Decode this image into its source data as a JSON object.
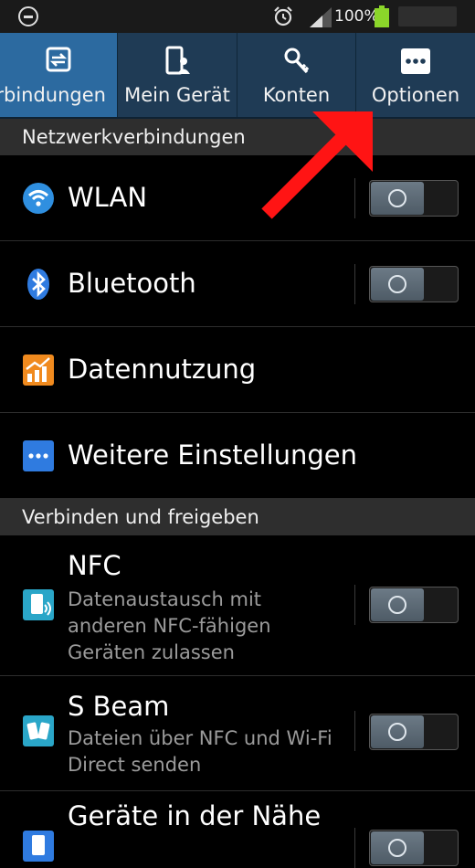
{
  "status_bar": {
    "battery_text": "100%"
  },
  "tabs": [
    {
      "label": "Verbindungen",
      "icon": "connections-icon",
      "active": true
    },
    {
      "label": "Mein Gerät",
      "icon": "device-icon"
    },
    {
      "label": "Konten",
      "icon": "accounts-key-icon"
    },
    {
      "label": "Optionen",
      "icon": "more-options-icon"
    }
  ],
  "sections": {
    "network": "Netzwerkverbindungen",
    "connect_share": "Verbinden und freigeben"
  },
  "rows": {
    "wlan": {
      "title": "WLAN",
      "icon": "wifi-icon"
    },
    "bluetooth": {
      "title": "Bluetooth",
      "icon": "bluetooth-icon"
    },
    "data_usage": {
      "title": "Datennutzung",
      "icon": "data-usage-icon"
    },
    "more_settings": {
      "title": "Weitere Einstellungen",
      "icon": "more-icon"
    },
    "nfc": {
      "title": "NFC",
      "subtitle": "Datenaustausch mit anderen NFC-fähigen Geräten zulassen",
      "icon": "nfc-icon"
    },
    "sbeam": {
      "title": "S Beam",
      "subtitle": "Dateien über NFC und Wi-Fi Direct senden",
      "icon": "sbeam-icon"
    },
    "nearby": {
      "title": "Geräte in der Nähe",
      "icon": "nearby-devices-icon"
    }
  },
  "colors": {
    "accent": "#2c6aa0",
    "arrow": "#ff1414",
    "section_bg": "#2e2e2e"
  }
}
